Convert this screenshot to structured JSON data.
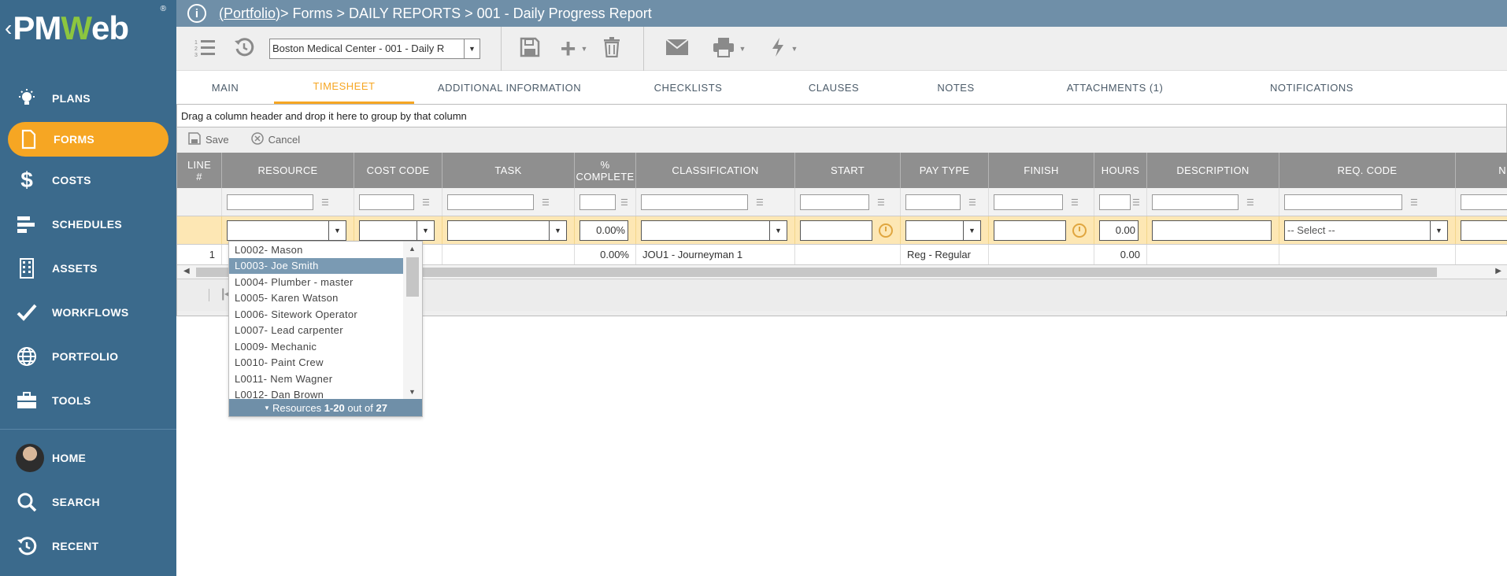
{
  "app": {
    "logo_text_left": "PM",
    "logo_text_accent": "W",
    "logo_text_right": "eb",
    "logo_reg": "®"
  },
  "sidebar": {
    "items": [
      {
        "label": "PLANS",
        "icon": "lightbulb-icon"
      },
      {
        "label": "FORMS",
        "icon": "document-icon",
        "active": true
      },
      {
        "label": "COSTS",
        "icon": "dollar-icon"
      },
      {
        "label": "SCHEDULES",
        "icon": "gantt-icon"
      },
      {
        "label": "ASSETS",
        "icon": "building-icon"
      },
      {
        "label": "WORKFLOWS",
        "icon": "checkmark-icon"
      },
      {
        "label": "PORTFOLIO",
        "icon": "globe-icon"
      },
      {
        "label": "TOOLS",
        "icon": "toolbox-icon"
      }
    ],
    "bottom_items": [
      {
        "label": "HOME",
        "icon": "avatar"
      },
      {
        "label": "SEARCH",
        "icon": "search-icon"
      },
      {
        "label": "RECENT",
        "icon": "history-icon"
      }
    ]
  },
  "header": {
    "breadcrumb_link": "(Portfolio)",
    "breadcrumb_rest": " > Forms > DAILY REPORTS > 001 - Daily Progress Report"
  },
  "toolbar": {
    "record_select_value": "Boston Medical Center - 001 - Daily R"
  },
  "tabs": [
    {
      "label": "MAIN"
    },
    {
      "label": "TIMESHEET",
      "active": true
    },
    {
      "label": "ADDITIONAL INFORMATION"
    },
    {
      "label": "CHECKLISTS"
    },
    {
      "label": "CLAUSES"
    },
    {
      "label": "NOTES"
    },
    {
      "label": "ATTACHMENTS (1)"
    },
    {
      "label": "NOTIFICATIONS"
    }
  ],
  "grid": {
    "group_hint": "Drag a column header and drop it here to group by that column",
    "save_label": "Save",
    "cancel_label": "Cancel",
    "columns": [
      {
        "label": "LINE\n#"
      },
      {
        "label": "RESOURCE"
      },
      {
        "label": "COST CODE"
      },
      {
        "label": "TASK"
      },
      {
        "label": "%\nCOMPLETE"
      },
      {
        "label": "CLASSIFICATION"
      },
      {
        "label": "START"
      },
      {
        "label": "PAY TYPE"
      },
      {
        "label": "FINISH"
      },
      {
        "label": "HOURS"
      },
      {
        "label": "DESCRIPTION"
      },
      {
        "label": "REQ. CODE"
      },
      {
        "label": "N"
      }
    ],
    "edit_row": {
      "percent": "0.00%",
      "hours": "0.00",
      "req_code": "-- Select --"
    },
    "rows": [
      {
        "line": "1",
        "resource": "",
        "cost_code": "",
        "task": "",
        "percent": "0.00%",
        "classification": "JOU1 - Journeyman 1",
        "start": "",
        "pay_type": "Reg - Regular",
        "finish": "",
        "hours": "0.00",
        "description": "",
        "req_code": ""
      }
    ]
  },
  "resource_dropdown": {
    "items": [
      {
        "label": "L0002- Mason"
      },
      {
        "label": "L0003- Joe Smith",
        "selected": true
      },
      {
        "label": "L0004- Plumber - master"
      },
      {
        "label": "L0005- Karen Watson"
      },
      {
        "label": "L0006- Sitework Operator"
      },
      {
        "label": "L0007- Lead carpenter"
      },
      {
        "label": "L0009- Mechanic"
      },
      {
        "label": "L0010- Paint Crew"
      },
      {
        "label": "L0011- Nem Wagner"
      },
      {
        "label": "L0012- Dan Brown"
      }
    ],
    "footer_prefix": "Resources ",
    "footer_range": "1-20",
    "footer_mid": " out of ",
    "footer_total": "27"
  }
}
